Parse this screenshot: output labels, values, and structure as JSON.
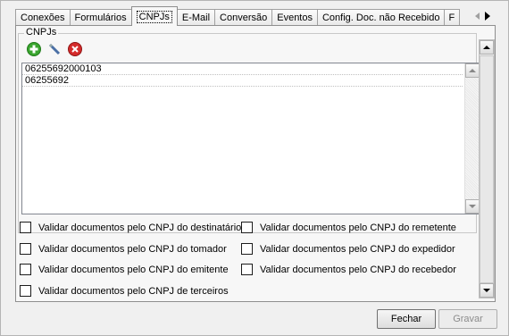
{
  "tabs": [
    {
      "label": "Conexões",
      "active": false
    },
    {
      "label": "Formulários",
      "active": false
    },
    {
      "label": "CNPJs",
      "active": true
    },
    {
      "label": "E-Mail",
      "active": false
    },
    {
      "label": "Conversão",
      "active": false
    },
    {
      "label": "Eventos",
      "active": false
    },
    {
      "label": "Config. Doc. não Recebido",
      "active": false
    },
    {
      "label": "F",
      "active": false
    }
  ],
  "group": {
    "label": "CNPJs"
  },
  "toolbar": {
    "add_icon": "add-icon",
    "edit_icon": "edit-icon",
    "delete_icon": "delete-icon",
    "colors": {
      "add": "#3aa52f",
      "delete": "#d42b2b"
    }
  },
  "list": {
    "items": [
      "06255692000103",
      "06255692"
    ]
  },
  "checkboxes": {
    "destinatario": "Validar documentos pelo CNPJ do destinatário",
    "remetente": "Validar documentos pelo CNPJ do remetente",
    "tomador": "Validar documentos pelo CNPJ do tomador",
    "expedidor": "Validar documentos pelo CNPJ do expedidor",
    "emitente": "Validar documentos pelo CNPJ do emitente",
    "recebedor": "Validar documentos pelo CNPJ do recebedor",
    "terceiros": "Validar documentos pelo CNPJ de terceiros"
  },
  "footer": {
    "close_label": "Fechar",
    "save_label": "Gravar"
  }
}
